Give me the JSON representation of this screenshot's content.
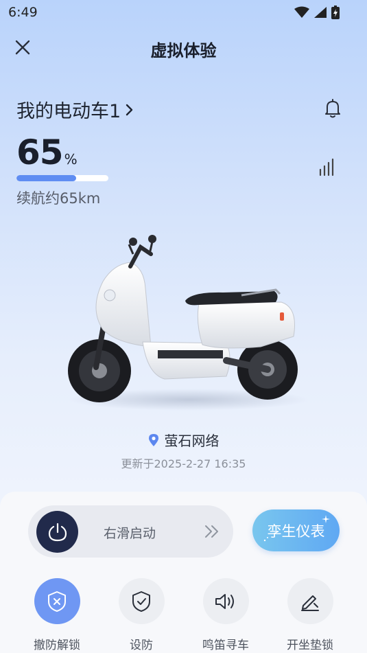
{
  "status_bar": {
    "time": "6:49"
  },
  "header": {
    "title": "虚拟体验"
  },
  "vehicle": {
    "name": "我的电动车1"
  },
  "battery": {
    "value": "65",
    "unit": "%",
    "level": 0.65
  },
  "range": {
    "text": "续航约65km"
  },
  "location": {
    "name": "萤石网络",
    "updated": "更新于2025-2-27 16:35"
  },
  "start_slider": {
    "label": "右滑启动"
  },
  "twin_button": {
    "label": "孪生仪表"
  },
  "actions": [
    {
      "label": "撤防解锁",
      "icon": "shield-x-icon",
      "active": true
    },
    {
      "label": "设防",
      "icon": "shield-check-icon",
      "active": false
    },
    {
      "label": "鸣笛寻车",
      "icon": "speaker-icon",
      "active": false
    },
    {
      "label": "开坐垫锁",
      "icon": "edit-pen-icon",
      "active": false
    }
  ],
  "colors": {
    "accent": "#6f97f3",
    "knob": "#212a4b",
    "twin_start": "#79c6ee",
    "twin_end": "#5fa8f3"
  }
}
